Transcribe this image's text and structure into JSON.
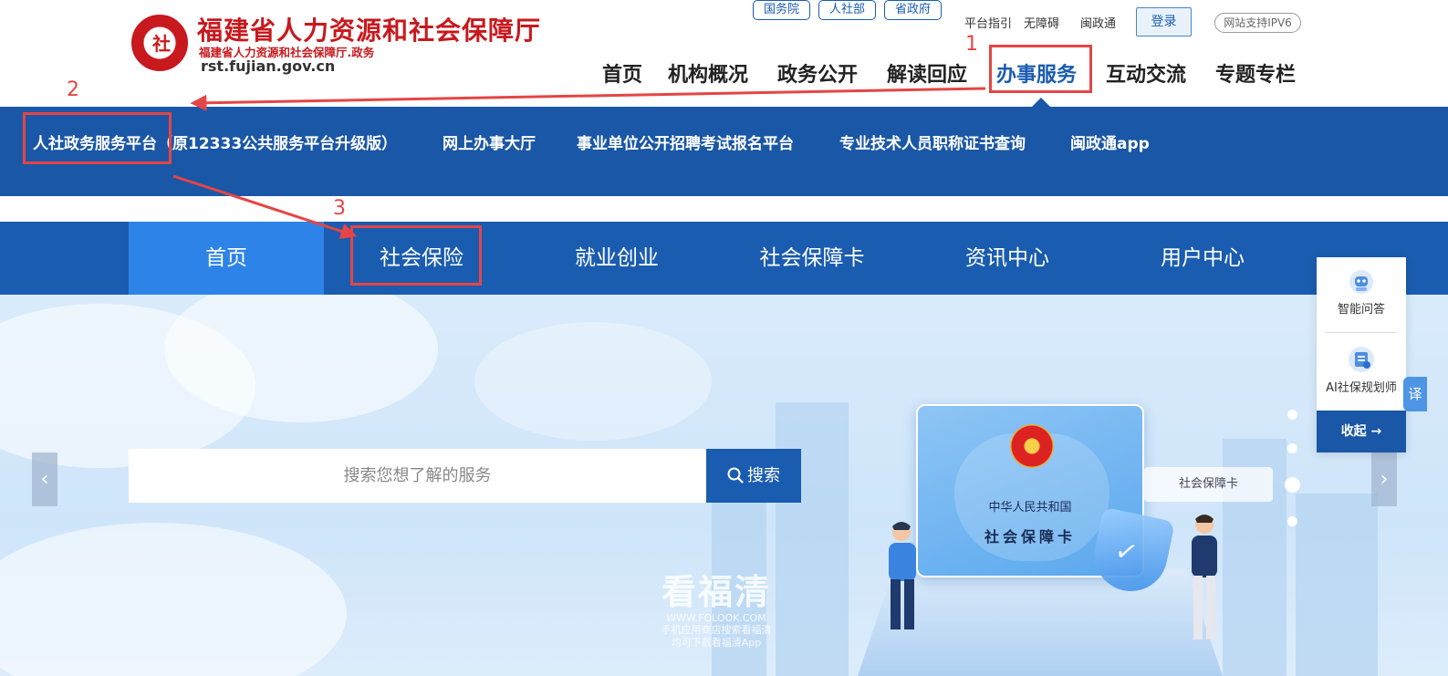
{
  "header": {
    "site_title": "福建省人力资源和社会保障厅",
    "site_subtitle": "福建省人力资源和社会保障厅.政务",
    "domain": "rst.fujian.gov.cn",
    "emblem_text": "社",
    "top_pills": [
      "国务院",
      "人社部",
      "省政府"
    ],
    "top_links": [
      "平台指引",
      "无障碍",
      "闽政通"
    ],
    "login_label": "登录",
    "ipv6_label": "网站支持IPV6"
  },
  "main_nav": {
    "items": [
      "首页",
      "机构概况",
      "政务公开",
      "解读回应",
      "办事服务",
      "互动交流",
      "专题专栏"
    ],
    "active": "办事服务"
  },
  "dropdown": {
    "links": [
      "人社政务服务平台（原12333公共服务平台升级版）",
      "网上办事大厅",
      "事业单位公开招聘考试报名平台",
      "专业技术人员职称证书查询",
      "闽政通app"
    ]
  },
  "portal_nav": {
    "tabs": [
      "首页",
      "社会保险",
      "就业创业",
      "社会保障卡",
      "资讯中心",
      "用户中心"
    ],
    "active": "首页"
  },
  "hero": {
    "search_placeholder": "搜索您想了解的服务",
    "search_button": "搜索",
    "prev_arrow": "‹",
    "next_arrow": "›",
    "card_country": "中华人民共和国",
    "card_title": "社会保障卡",
    "card_label": "社会保障卡"
  },
  "watermark": {
    "title": "看福清",
    "url": "WWW.FQLOOK.COM",
    "line1": "手机应用商店搜索看福清",
    "line2": "均可下载看福清App"
  },
  "float_panel": {
    "qa_label": "智能问答",
    "planner_label": "AI社保规划师",
    "collapse_label": "收起 →",
    "translate_label": "译"
  },
  "annotations": {
    "step1": "1",
    "step2": "2",
    "step3": "3",
    "color": "#e54545"
  },
  "colors": {
    "brand_red": "#c8191e",
    "nav_blue": "#1a5cb0",
    "active_tab_blue": "#2d83e8"
  }
}
